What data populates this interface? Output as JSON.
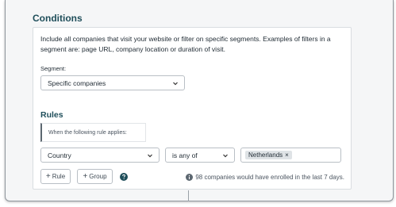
{
  "conditions": {
    "title": "Conditions",
    "intro": "Include all companies that visit your website or filter on specific segments. Examples of filters in a segment are: page URL, company location or duration of visit.",
    "segment_label": "Segment:",
    "segment_value": "Specific companies"
  },
  "rules": {
    "title": "Rules",
    "hint": "When the following rule applies:",
    "field_value": "Country",
    "operator_value": "is any of",
    "selected_values": [
      "Netherlands"
    ],
    "chip_remove_glyph": "×"
  },
  "actions": {
    "add_rule_label": "Rule",
    "add_group_label": "Group",
    "plus_glyph": "+"
  },
  "footer": {
    "enroll_note": "98 companies would have enrolled in the last 7 days."
  },
  "colors": {
    "heading": "#1f4e5a",
    "help_icon": "#1f4e5a",
    "chip_bg": "#dfe3e6"
  },
  "icons": {
    "select_chevron": "chevron-down-icon",
    "help": "help-circle-icon",
    "info": "info-circle-icon"
  }
}
